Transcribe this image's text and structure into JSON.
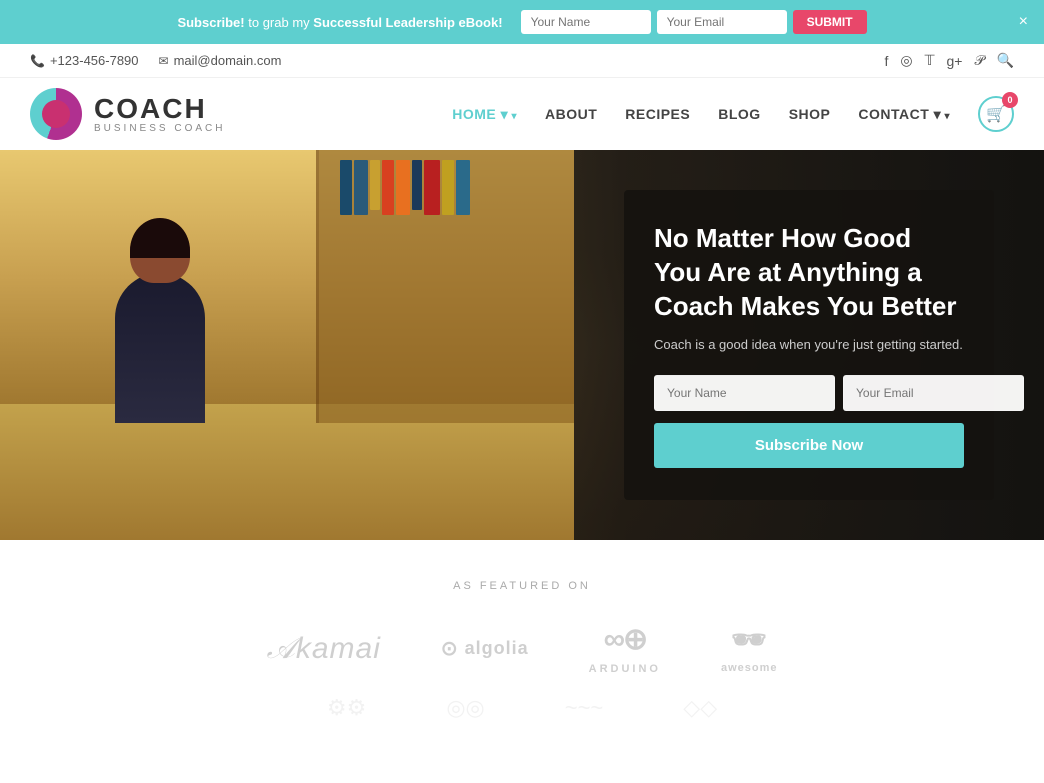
{
  "banner": {
    "text_pre": "Subscribe!",
    "text_mid": " to grab my ",
    "text_highlight": "Successful Leadership eBook!",
    "name_placeholder": "Your Name",
    "email_placeholder": "Your Email",
    "submit_label": "SUBMIT",
    "close": "×"
  },
  "contact_bar": {
    "phone": "+123-456-7890",
    "email": "mail@domain.com"
  },
  "logo": {
    "brand_name": "COACH",
    "brand_sub": "BUSINESS COACH"
  },
  "nav": {
    "items": [
      {
        "label": "HOME",
        "active": true,
        "has_arrow": true
      },
      {
        "label": "ABOUT",
        "active": false,
        "has_arrow": false
      },
      {
        "label": "RECIPES",
        "active": false,
        "has_arrow": false
      },
      {
        "label": "BLOG",
        "active": false,
        "has_arrow": false
      },
      {
        "label": "SHOP",
        "active": false,
        "has_arrow": false
      },
      {
        "label": "CONTACT",
        "active": false,
        "has_arrow": true
      }
    ],
    "cart_badge": "0"
  },
  "hero": {
    "heading": "No Matter How Good You Are at Anything a Coach Makes You Better",
    "subtext": "Coach is a good idea when you're just getting started.",
    "name_placeholder": "Your Name",
    "email_placeholder": "Your Email",
    "subscribe_label": "Subscribe Now"
  },
  "featured": {
    "section_label": "AS FEATURED ON",
    "logos": [
      {
        "name": "Akamai",
        "symbol": "𝒜",
        "type": "akamai"
      },
      {
        "name": "algolia",
        "symbol": "⊙",
        "type": "algolia"
      },
      {
        "name": "ARDUINO",
        "symbol": "∞+",
        "type": "arduino"
      },
      {
        "name": "awesome",
        "symbol": "🕶",
        "type": "awesome"
      }
    ]
  }
}
